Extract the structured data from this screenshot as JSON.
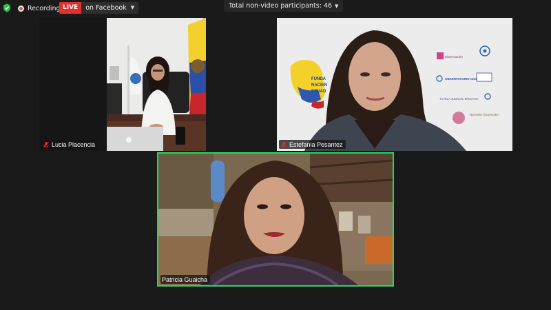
{
  "top_bar": {
    "recording_label": "Recording",
    "live_badge": "LIVE",
    "live_destination": "on Facebook",
    "participants_text": "Total non-video participants: 46"
  },
  "tiles": [
    {
      "name": "Lucia Placencia",
      "muted": true,
      "active_speaker": false
    },
    {
      "name": "Estefania Pesantez",
      "muted": true,
      "active_speaker": false
    },
    {
      "name": "Patricia Guaicha",
      "muted": false,
      "active_speaker": true
    }
  ],
  "backdrop_text": {
    "foundation_lines": [
      "FUNDA",
      "NACIEN",
      "ECUAD"
    ],
    "logo_1": "Observatorio",
    "logo_2": "OBSERVATORIO CIUDADANO",
    "logo_3": "TUTELA JUDICIAL EFECTIVA",
    "logo_4": "Aprender Emprender"
  },
  "colors": {
    "background": "#1a1a1a",
    "live_red": "#e0312c",
    "active_speaker_border": "#23d959",
    "recording_dot": "#e2554f"
  },
  "icons": [
    "shield-icon",
    "recording-icon",
    "chevron-down-icon",
    "mic-muted-icon"
  ]
}
